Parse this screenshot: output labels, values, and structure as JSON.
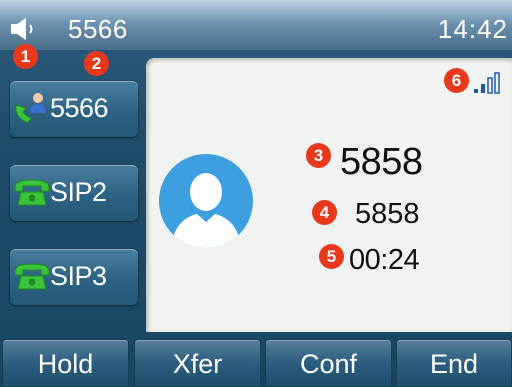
{
  "status_bar": {
    "account": "5566",
    "time": "14:42",
    "icons": {
      "handsfree": "speaker-icon"
    }
  },
  "line_keys": [
    {
      "label": "5566",
      "icon": "user-handset-icon"
    },
    {
      "label": "SIP2",
      "icon": "phone-icon"
    },
    {
      "label": "SIP3",
      "icon": "phone-icon"
    }
  ],
  "call": {
    "number": "5858",
    "name": "5858",
    "duration": "00:24",
    "avatar": "contact-avatar-icon",
    "signal": "signal-strength-icon"
  },
  "softkeys": [
    {
      "label": "Hold"
    },
    {
      "label": "Xfer"
    },
    {
      "label": "Conf"
    },
    {
      "label": "End"
    }
  ],
  "markers": [
    "1",
    "2",
    "3",
    "4",
    "5",
    "6"
  ],
  "colors": {
    "marker": "#e8391d",
    "call_panel_bg": "#f1f2f2",
    "signal": "#1d5aa6",
    "handset_green": "#3cc23c"
  }
}
